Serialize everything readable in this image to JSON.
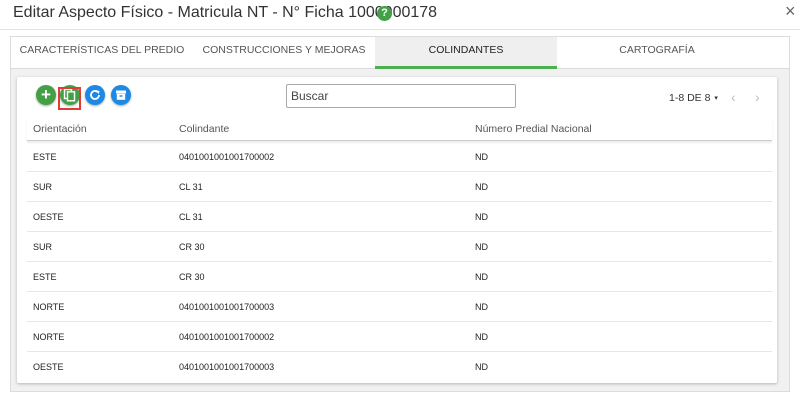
{
  "dialog": {
    "title": "Editar Aspecto Físico - Matricula NT - N° Ficha 1000000178",
    "help_icon": "?",
    "close_label": "×"
  },
  "tabs": [
    {
      "label": "CARACTERÍSTICAS DEL PREDIO",
      "active": false
    },
    {
      "label": "CONSTRUCCIONES Y MEJORAS",
      "active": false
    },
    {
      "label": "COLINDANTES",
      "active": true
    },
    {
      "label": "CARTOGRAFÍA",
      "active": false
    }
  ],
  "toolbar": {
    "add_label": "+",
    "add_icon": "plus-icon",
    "copy_icon": "copy-icon",
    "refresh_icon": "refresh-icon",
    "box_icon": "archive-box-icon",
    "search_placeholder": "Buscar",
    "pager_label": "1-8 DE 8",
    "pager_caret": "▾",
    "prev_label": "‹",
    "next_label": "›"
  },
  "table": {
    "columns": [
      "Orientación",
      "Colindante",
      "Número Predial Nacional"
    ],
    "rows": [
      [
        "ESTE",
        "0401001001001700002",
        "ND"
      ],
      [
        "SUR",
        "CL 31",
        "ND"
      ],
      [
        "OESTE",
        "CL 31",
        "ND"
      ],
      [
        "SUR",
        "CR 30",
        "ND"
      ],
      [
        "ESTE",
        "CR 30",
        "ND"
      ],
      [
        "NORTE",
        "0401001001001700003",
        "ND"
      ],
      [
        "NORTE",
        "0401001001001700002",
        "ND"
      ],
      [
        "OESTE",
        "0401001001001700003",
        "ND"
      ]
    ]
  },
  "colors": {
    "accent_green": "#43a047",
    "accent_blue": "#1e88e5",
    "highlight_red": "#e53935",
    "tab_underline": "#4caf50"
  }
}
